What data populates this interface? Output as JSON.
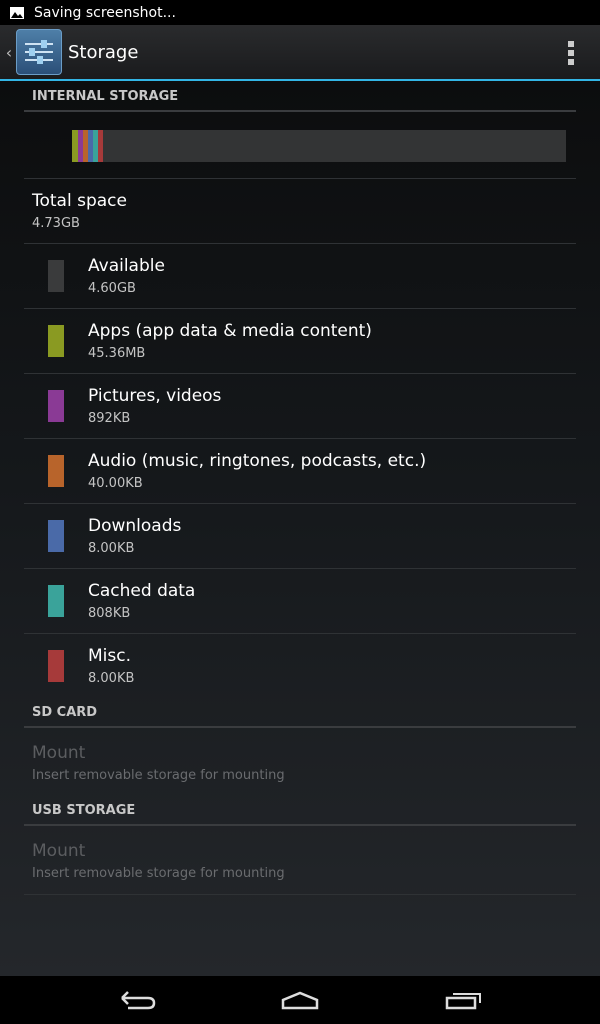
{
  "status_bar": {
    "notification_text": "Saving screenshot...",
    "notification_icon": "image-icon"
  },
  "action_bar": {
    "title": "Storage",
    "app_icon": "settings-sliders-icon",
    "accent": "#33b5e5"
  },
  "internal_storage": {
    "header": "INTERNAL STORAGE",
    "total": {
      "label": "Total space",
      "value": "4.73GB"
    },
    "usage_segments": [
      {
        "name": "apps",
        "color": "#8a9a22",
        "fraction": 0.012
      },
      {
        "name": "pictures",
        "color": "#8a3a95",
        "fraction": 0.01
      },
      {
        "name": "audio",
        "color": "#b8642b",
        "fraction": 0.01
      },
      {
        "name": "downloads",
        "color": "#4a6aa8",
        "fraction": 0.01
      },
      {
        "name": "cached",
        "color": "#3aa39a",
        "fraction": 0.01
      },
      {
        "name": "misc",
        "color": "#a63a3a",
        "fraction": 0.01
      }
    ],
    "items": [
      {
        "label": "Available",
        "value": "4.60GB",
        "color": "#3a3b3c"
      },
      {
        "label": "Apps (app data & media content)",
        "value": "45.36MB",
        "color": "#8a9a22"
      },
      {
        "label": "Pictures, videos",
        "value": "892KB",
        "color": "#8a3a95"
      },
      {
        "label": "Audio (music, ringtones, podcasts, etc.)",
        "value": "40.00KB",
        "color": "#b8642b"
      },
      {
        "label": "Downloads",
        "value": "8.00KB",
        "color": "#4a6aa8"
      },
      {
        "label": "Cached data",
        "value": "808KB",
        "color": "#3aa39a"
      },
      {
        "label": "Misc.",
        "value": "8.00KB",
        "color": "#a63a3a"
      }
    ]
  },
  "sd_card": {
    "header": "SD CARD",
    "mount": {
      "label": "Mount",
      "description": "Insert removable storage for mounting"
    }
  },
  "usb_storage": {
    "header": "USB STORAGE",
    "mount": {
      "label": "Mount",
      "description": "Insert removable storage for mounting"
    }
  },
  "nav_bar": {
    "back": "back-icon",
    "home": "home-icon",
    "recents": "recent-apps-icon"
  }
}
